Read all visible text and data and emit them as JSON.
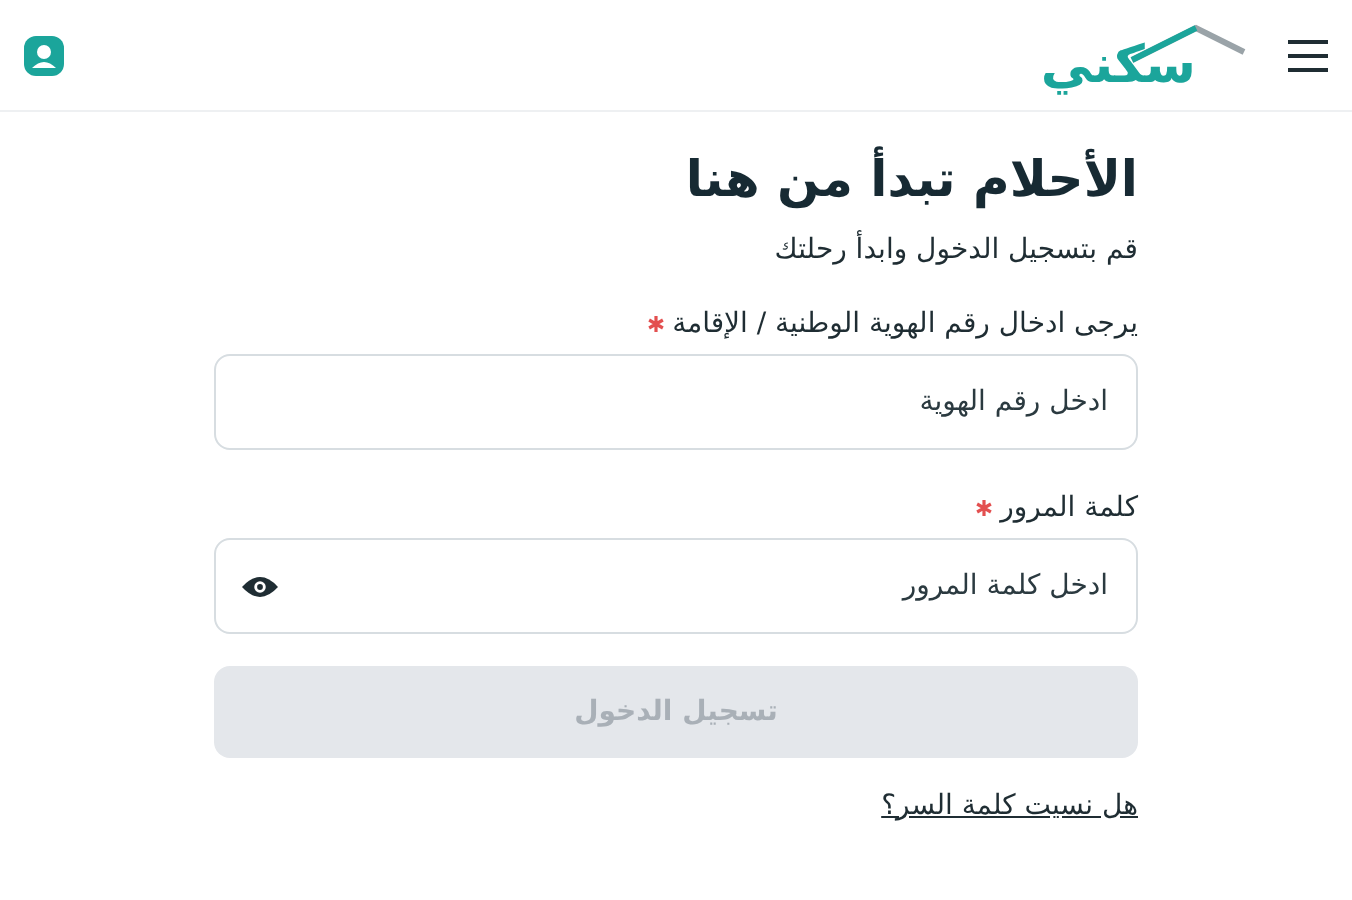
{
  "header": {
    "logo": "سكني"
  },
  "form": {
    "title": "الأحلام تبدأ من هنا",
    "subtitle": "قم بتسجيل الدخول وابدأ رحلتك",
    "fields": [
      {
        "kind": "text",
        "label": "يرجى ادخال رقم الهوية الوطنية / الإقامة",
        "required": true,
        "placeholder": "ادخل رقم الهوية"
      },
      {
        "kind": "password",
        "label": "كلمة المرور",
        "required": true,
        "placeholder": "ادخل كلمة المرور"
      }
    ],
    "submit": {
      "label": "تسجيل الدخول",
      "disabled": true
    },
    "forgot_link": "هل نسيت كلمة السر؟"
  }
}
